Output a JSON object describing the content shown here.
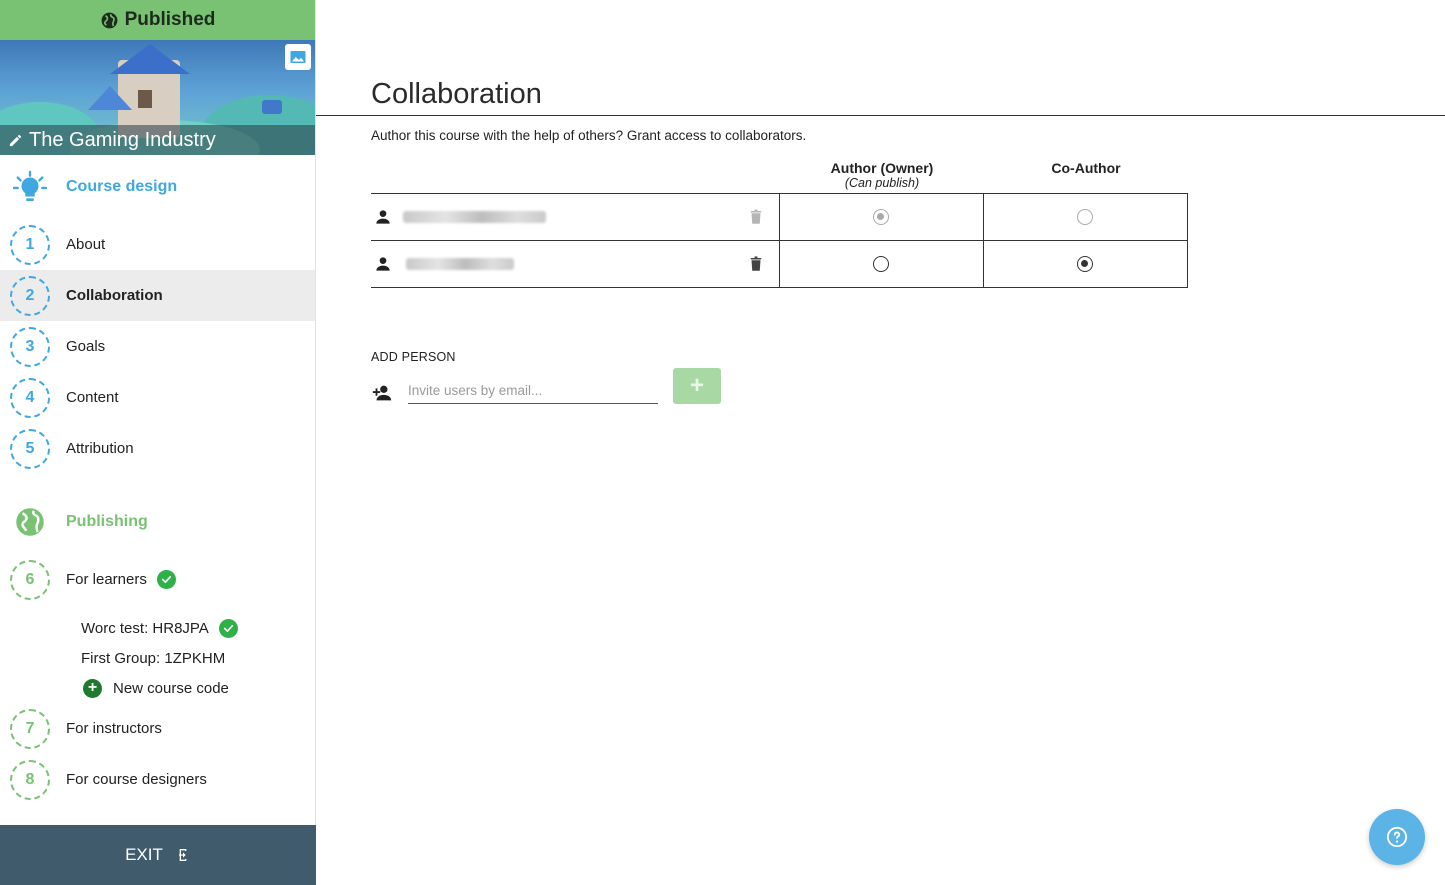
{
  "status": {
    "label": "Published",
    "icon": "globe-icon",
    "color": "#79c273"
  },
  "course": {
    "title": "The Gaming Industry"
  },
  "sidebar": {
    "course_design": {
      "label": "Course design",
      "icon": "lightbulb-icon",
      "color": "#3fa8e0"
    },
    "design_steps": [
      {
        "num": "1",
        "label": "About"
      },
      {
        "num": "2",
        "label": "Collaboration",
        "active": true
      },
      {
        "num": "3",
        "label": "Goals"
      },
      {
        "num": "4",
        "label": "Content"
      },
      {
        "num": "5",
        "label": "Attribution"
      }
    ],
    "publishing": {
      "label": "Publishing",
      "icon": "globe-icon",
      "color": "#79c273"
    },
    "publish_steps": [
      {
        "num": "6",
        "label": "For learners",
        "complete": true
      },
      {
        "num": "7",
        "label": "For instructors"
      },
      {
        "num": "8",
        "label": "For course designers"
      }
    ],
    "course_codes": [
      {
        "label": "Worc test: HR8JPA",
        "complete": true
      },
      {
        "label": "First Group: 1ZPKHM"
      }
    ],
    "new_code_label": "New course code",
    "exit_label": "EXIT"
  },
  "main": {
    "title": "Collaboration",
    "intro": "Author this course with the help of others? Grant access to collaborators.",
    "columns": {
      "author": "Author (Owner)",
      "author_note": "(Can publish)",
      "coauthor": "Co-Author"
    },
    "collaborators": [
      {
        "name_hidden": true,
        "role": "author",
        "editable": false
      },
      {
        "name_hidden": true,
        "role": "coauthor",
        "editable": true
      }
    ],
    "add_person": {
      "label": "ADD PERSON",
      "placeholder": "Invite users by email...",
      "button": "+"
    }
  }
}
